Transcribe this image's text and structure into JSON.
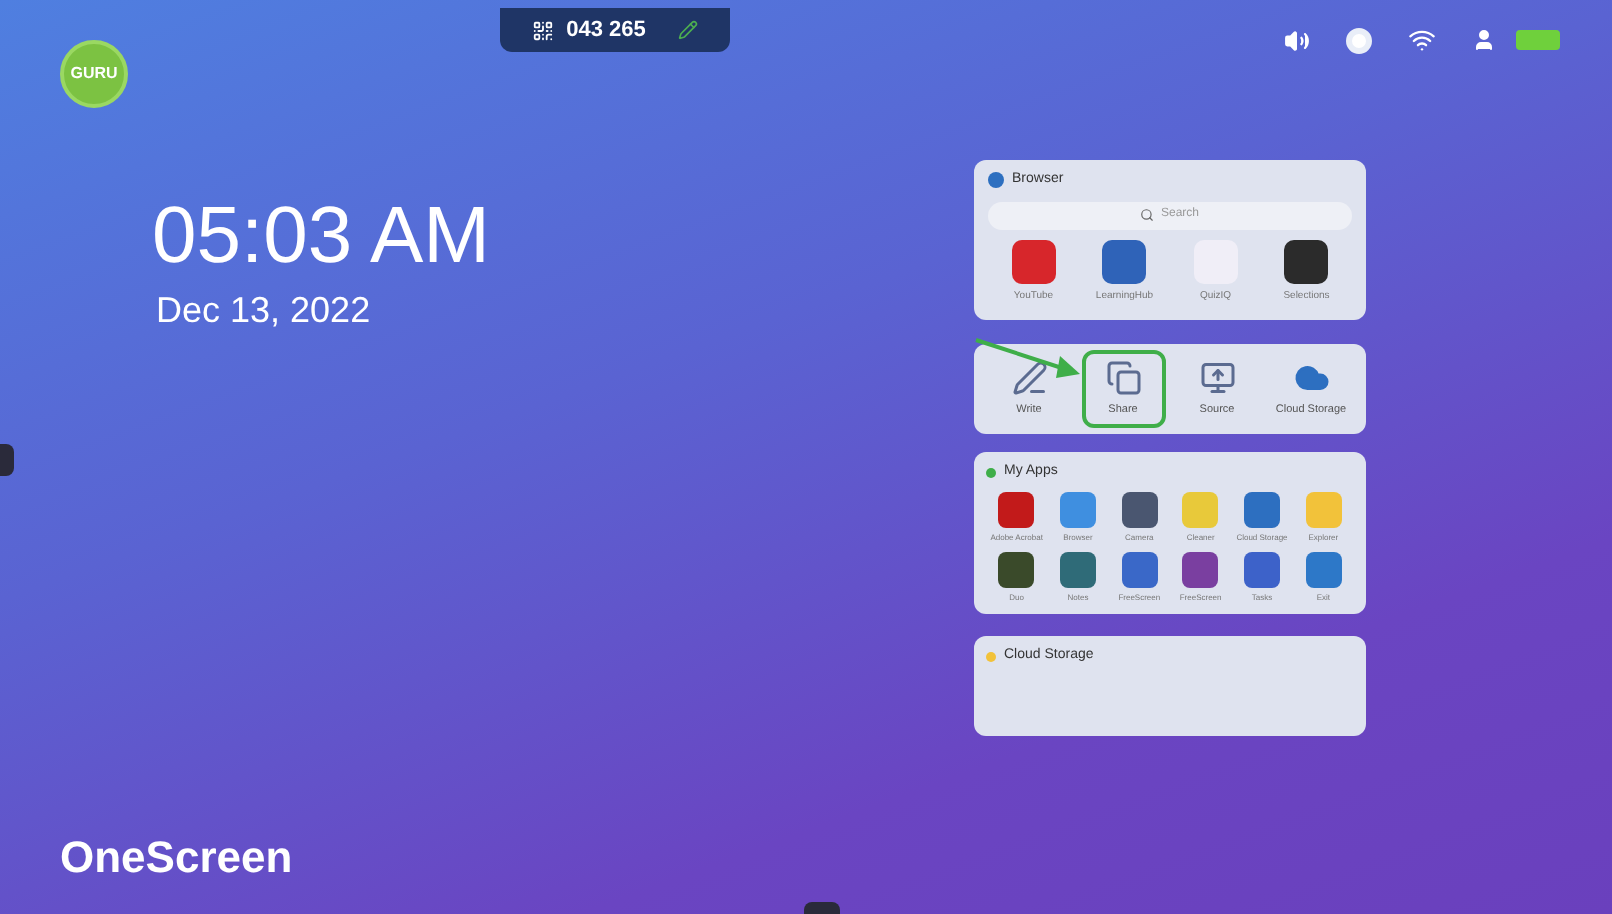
{
  "logo": {
    "text": "GURU"
  },
  "top_bar": {
    "code": "043 265"
  },
  "clock": {
    "time": "05:03 AM",
    "date": "Dec 13, 2022"
  },
  "brand": "OneScreen",
  "browser_panel": {
    "title": "Browser",
    "search": {
      "placeholder": "Search"
    },
    "shortcuts": [
      {
        "label": "YouTube",
        "color": "#d7262b"
      },
      {
        "label": "LearningHub",
        "color": "#2f63b8"
      },
      {
        "label": "QuizIQ",
        "color": "#f0eef7"
      },
      {
        "label": "Selections",
        "color": "#2b2b2b"
      }
    ]
  },
  "quick_actions": [
    {
      "label": "Write",
      "kind": "whiteboard",
      "selected": false
    },
    {
      "label": "Share",
      "kind": "share",
      "selected": true
    },
    {
      "label": "Source",
      "kind": "source",
      "selected": false
    },
    {
      "label": "Cloud Storage",
      "kind": "cloud",
      "selected": false
    }
  ],
  "apps_panel": {
    "title": "My Apps",
    "apps": [
      {
        "label": "Adobe Acrobat",
        "color": "#c21a1a"
      },
      {
        "label": "Browser",
        "color": "#3f8fe0"
      },
      {
        "label": "Camera",
        "color": "#4a5670"
      },
      {
        "label": "Cleaner",
        "color": "#e8c93a"
      },
      {
        "label": "Cloud Storage",
        "color": "#2d6fc0"
      },
      {
        "label": "Explorer",
        "color": "#f2c23a"
      },
      {
        "label": "Duo",
        "color": "#3a4a2a"
      },
      {
        "label": "Notes",
        "color": "#2f6b78"
      },
      {
        "label": "FreeScreen",
        "color": "#3a68c8"
      },
      {
        "label": "FreeScreen",
        "color": "#7a3fa0"
      },
      {
        "label": "Tasks",
        "color": "#3d62c9"
      },
      {
        "label": "Exit",
        "color": "#2d78c8"
      }
    ]
  },
  "cloud_panel": {
    "title": "Cloud Storage"
  }
}
